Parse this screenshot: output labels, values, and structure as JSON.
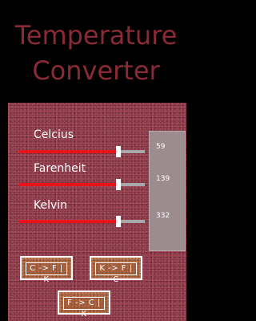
{
  "app": {
    "title_line1": "Temperature",
    "title_line2": "Converter"
  },
  "sliders": [
    {
      "label": "Celcius",
      "value": "59",
      "level": 0.8
    },
    {
      "label": "Farenheit",
      "value": "139",
      "level": 0.8
    },
    {
      "label": "Kelvin",
      "value": "332",
      "level": 0.8
    }
  ],
  "buttons": {
    "c_to_fk": "C -> F | K",
    "k_to_fc": "K -> F | C",
    "f_to_ck": "F -> C | K"
  },
  "colors": {
    "title": "#8a2a34",
    "panel": "#8d3444",
    "slider_fill": "#e8141c",
    "slider_track": "#a8a8a8",
    "button": "#a8613f"
  }
}
